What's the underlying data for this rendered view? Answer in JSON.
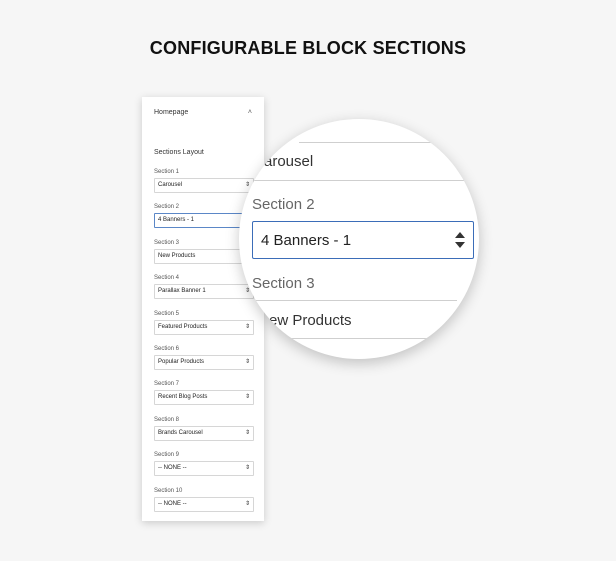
{
  "headline": "CONFIGURABLE BLOCK SECTIONS",
  "panel": {
    "title": "Homepage",
    "collapse_icon": "chevron-up-icon",
    "collapse_glyph": "˄",
    "layout_label": "Sections Layout",
    "select_arrow_glyph": "⇕",
    "sections": [
      {
        "label": "Section 1",
        "value": "Carousel"
      },
      {
        "label": "Section 2",
        "value": "4 Banners - 1"
      },
      {
        "label": "Section 3",
        "value": "New Products"
      },
      {
        "label": "Section 4",
        "value": "Parallax Banner 1"
      },
      {
        "label": "Section 5",
        "value": "Featured Products"
      },
      {
        "label": "Section 6",
        "value": "Popular Products"
      },
      {
        "label": "Section 7",
        "value": "Recent Blog Posts"
      },
      {
        "label": "Section 8",
        "value": "Brands Carousel"
      },
      {
        "label": "Section 9",
        "value": "-- NONE --"
      },
      {
        "label": "Section 10",
        "value": "-- NONE --"
      }
    ]
  },
  "magnifier": {
    "prev_value_partial": "arousel",
    "label": "Section 2",
    "value": "4 Banners - 1",
    "next_label": "Section 3",
    "next_value_partial": "ew Products"
  },
  "colors": {
    "active_border": "#3b6db8",
    "background": "#f6f6f6"
  }
}
